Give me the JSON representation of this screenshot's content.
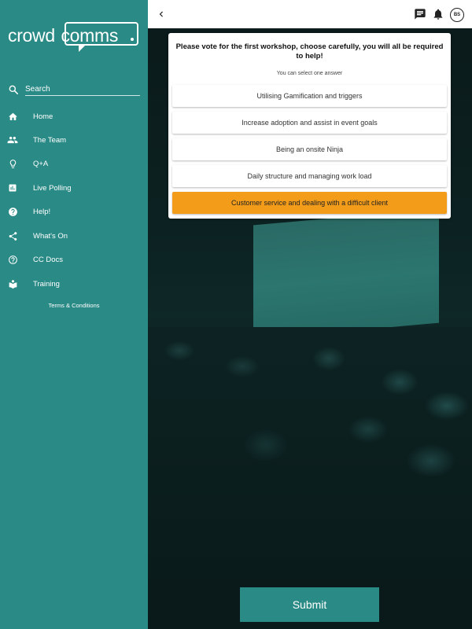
{
  "app": {
    "logo": "crowdcomms",
    "logo_left": "crowd",
    "logo_right": "comms"
  },
  "colors": {
    "sidebar": "#2a8a86",
    "accent_selected": "#f39c1a",
    "submit": "#2a8a86"
  },
  "sidebar": {
    "search": {
      "placeholder": "Search",
      "icon": "search-icon"
    },
    "items": [
      {
        "label": "Home",
        "icon": "home-icon"
      },
      {
        "label": "The Team",
        "icon": "people-icon"
      },
      {
        "label": "Q+A",
        "icon": "lightbulb-icon"
      },
      {
        "label": "Live Polling",
        "icon": "poll-icon"
      },
      {
        "label": "Help!",
        "icon": "help-icon"
      },
      {
        "label": "What's On",
        "icon": "share-icon"
      },
      {
        "label": "CC Docs",
        "icon": "question-circle-icon"
      },
      {
        "label": "Training",
        "icon": "book-reader-icon"
      }
    ],
    "terms": "Terms & Conditions"
  },
  "topbar": {
    "back_icon": "chevron-left-icon",
    "icons": [
      "chat-icon",
      "bell-icon"
    ],
    "avatar_initials": "BS"
  },
  "poll": {
    "question": "Please vote for the first workshop, choose carefully, you will all be required to help!",
    "hint": "You can select one answer",
    "options": [
      {
        "label": "Utilising Gamification and triggers",
        "selected": false
      },
      {
        "label": "Increase adoption and assist in event goals",
        "selected": false
      },
      {
        "label": "Being an onsite Ninja",
        "selected": false
      },
      {
        "label": "Daily structure and managing work load",
        "selected": false
      },
      {
        "label": "Customer service and dealing with a difficult client",
        "selected": true
      }
    ],
    "submit_label": "Submit"
  }
}
